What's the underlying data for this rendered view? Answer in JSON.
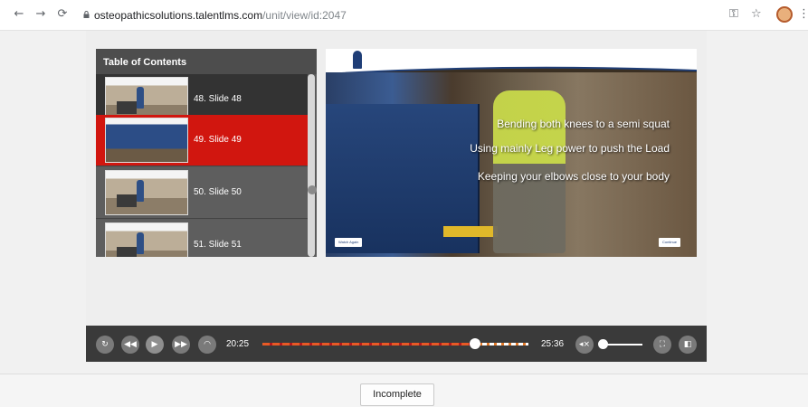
{
  "browser": {
    "url_host": "osteopathicsolutions.talentlms.com",
    "url_path": "/unit/view/id:2047",
    "back_icon": "arrow-left",
    "forward_icon": "arrow-right",
    "reload_icon": "reload",
    "key_icon": "key",
    "star_icon": "star",
    "menu_icon": "vertical-dots"
  },
  "toc": {
    "title": "Table of Contents",
    "items": [
      {
        "label": "48. Slide 48",
        "active": false
      },
      {
        "label": "49. Slide 49",
        "active": true
      },
      {
        "label": "50. Slide 50",
        "active": false
      },
      {
        "label": "51. Slide 51",
        "active": false
      }
    ],
    "active_color": "#d1160f"
  },
  "slide": {
    "lines": [
      "Bending both knees to a semi squat",
      "Using mainly Leg power to push the Load",
      "Keeping your elbows close to your body"
    ],
    "watch_again_label": "Watch Again",
    "continue_label": "Continue"
  },
  "player": {
    "current_time": "20:25",
    "total_time": "25:36",
    "progress_fraction": 0.8,
    "volume_fraction": 0.05,
    "buttons": [
      "replay",
      "rewind",
      "play",
      "fast-forward",
      "speed",
      "mute",
      "fullscreen",
      "sidebar-toggle"
    ]
  },
  "status": {
    "label": "Incomplete"
  }
}
